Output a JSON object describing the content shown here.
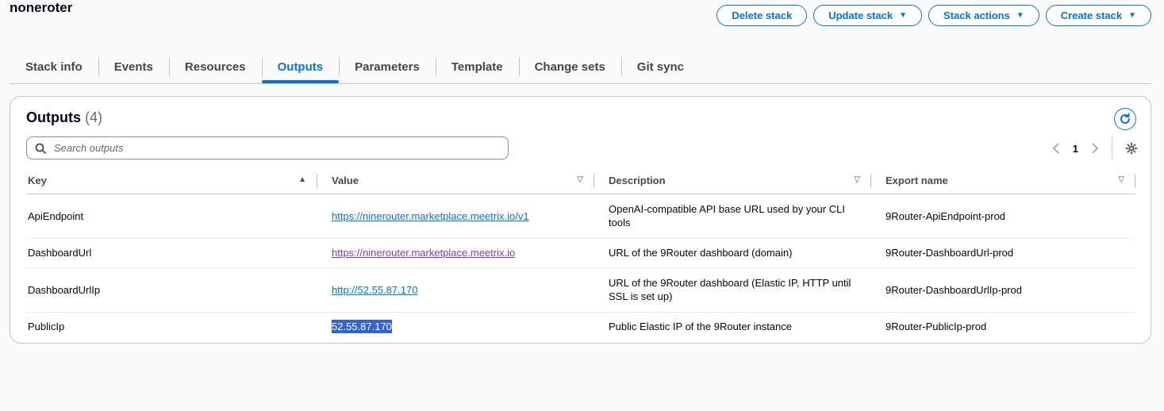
{
  "stack_name": "noneroter",
  "actions": {
    "delete": "Delete stack",
    "update": "Update stack",
    "stack_actions": "Stack actions",
    "create": "Create stack"
  },
  "tabs": [
    "Stack info",
    "Events",
    "Resources",
    "Outputs",
    "Parameters",
    "Template",
    "Change sets",
    "Git sync"
  ],
  "active_tab": "Outputs",
  "panel": {
    "title": "Outputs",
    "count": "(4)",
    "search_placeholder": "Search outputs",
    "page": "1"
  },
  "columns": [
    "Key",
    "Value",
    "Description",
    "Export name"
  ],
  "rows": [
    {
      "key": "ApiEndpoint",
      "value": "https://ninerouter.marketplace.meetrix.io/v1",
      "description": "OpenAI-compatible API base URL used by your CLI tools",
      "export": "9Router-ApiEndpoint-prod"
    },
    {
      "key": "DashboardUrl",
      "value": "https://ninerouter.marketplace.meetrix.io",
      "description": "URL of the 9Router dashboard (domain)",
      "export": "9Router-DashboardUrl-prod"
    },
    {
      "key": "DashboardUrlIp",
      "value": "http://52.55.87.170",
      "description": "URL of the 9Router dashboard (Elastic IP, HTTP until SSL is set up)",
      "export": "9Router-DashboardUrlIp-prod"
    },
    {
      "key": "PublicIp",
      "value": "52.55.87.170",
      "description": "Public Elastic IP of the 9Router instance",
      "export": "9Router-PublicIp-prod"
    }
  ],
  "colors": {
    "accent": "#0972d3",
    "visited_link": "#7d3cbd",
    "selection": "#3365c9"
  }
}
